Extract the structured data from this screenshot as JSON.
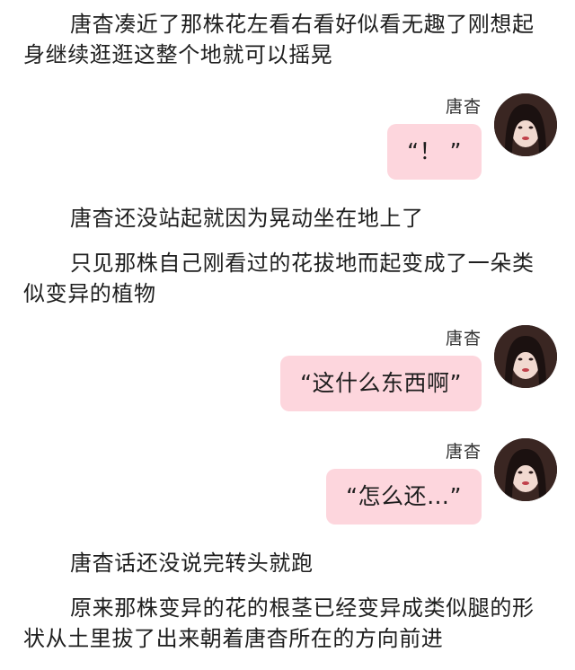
{
  "narration": {
    "p1": "唐杳凑近了那株花左看右看好似看无趣了刚想起身继续逛逛这整个地就可以摇晃",
    "p2": "唐杳还没站起就因为晃动坐在地上了",
    "p3": "只见那株自己刚看过的花拔地而起变成了一朵类似变异的植物",
    "p4": "唐杳话还没说完转头就跑",
    "p5": "原来那株变异的花的根茎已经变异成类似腿的形状从土里拔了出来朝着唐杳所在的方向前进"
  },
  "messages": [
    {
      "sender": "唐杳",
      "text": "“！ ”"
    },
    {
      "sender": "唐杳",
      "text": "“这什么东西啊”"
    },
    {
      "sender": "唐杳",
      "text": "“怎么还…”"
    }
  ],
  "colors": {
    "bubble": "#fdd6dd",
    "text": "#1e1e1e"
  },
  "icons": {
    "avatar": "character-portrait-avatar"
  }
}
